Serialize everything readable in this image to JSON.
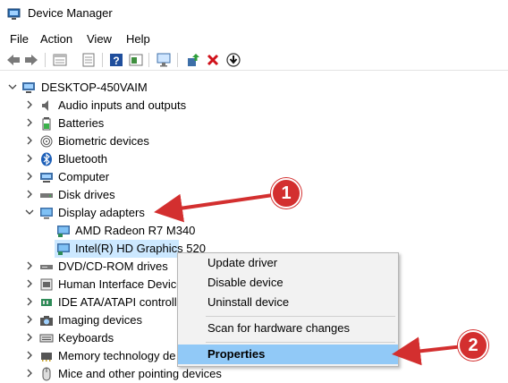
{
  "window": {
    "title": "Device Manager"
  },
  "menu": [
    "File",
    "Action",
    "View",
    "Help"
  ],
  "tree": {
    "root": "DESKTOP-450VAIM",
    "items": [
      "Audio inputs and outputs",
      "Batteries",
      "Biometric devices",
      "Bluetooth",
      "Computer",
      "Disk drives",
      "Display adapters",
      "AMD Radeon R7 M340",
      "Intel(R) HD Graphics 520",
      "DVD/CD-ROM drives",
      "Human Interface Device",
      "IDE ATA/ATAPI controlle",
      "Imaging devices",
      "Keyboards",
      "Memory technology de",
      "Mice and other pointing devices"
    ]
  },
  "context_menu": {
    "items": [
      "Update driver",
      "Disable device",
      "Uninstall device",
      "Scan for hardware changes",
      "Properties"
    ]
  },
  "annotations": {
    "badge1": "1",
    "badge2": "2"
  },
  "colors": {
    "accent": "#d32f2f",
    "highlight": "#91c9f7",
    "selected_row": "#cce8ff"
  }
}
